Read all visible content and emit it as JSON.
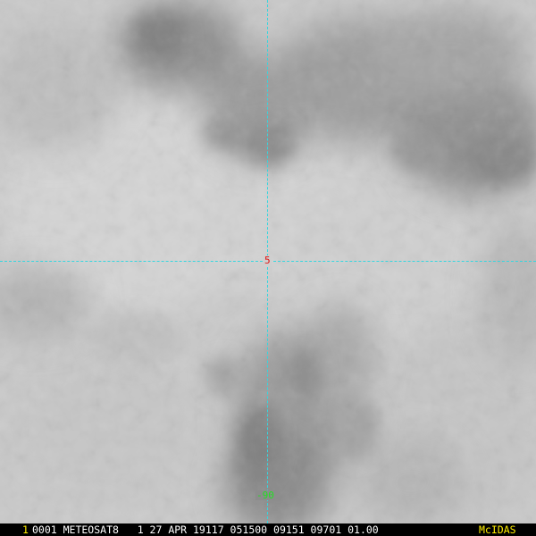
{
  "image": {
    "description_icon": "satellite-cloud-imagery"
  },
  "grid": {
    "latitude_label": "5",
    "longitude_label": "-90",
    "line_color": "#35d6df",
    "latitude_label_color": "#e01010",
    "longitude_label_color": "#22e022"
  },
  "status_bar": {
    "frame_number": "1",
    "text": "0001 METEOSAT8   1 27 APR 19117 051500 09151 09701 01.00",
    "brand": "McIDAS",
    "frame_color": "#ffee00",
    "text_color": "#ffffff",
    "brand_color": "#ffee00"
  }
}
